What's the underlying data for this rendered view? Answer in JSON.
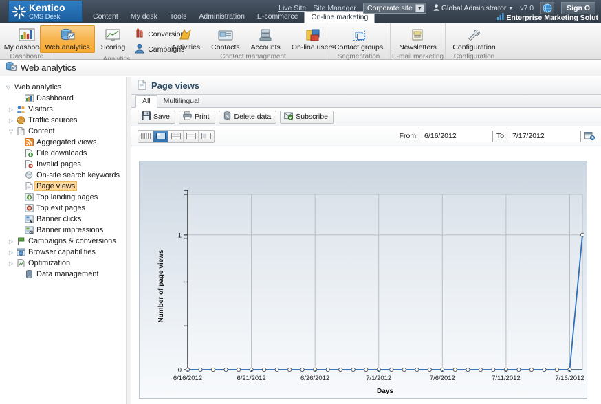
{
  "app": {
    "brand_title": "Kentico",
    "brand_subtitle": "CMS Desk",
    "accent_blue": "#1b5e9e",
    "accent_orange": "#f6a92f"
  },
  "topbar": {
    "nav": [
      {
        "label": "Content",
        "active": false
      },
      {
        "label": "My desk",
        "active": false
      },
      {
        "label": "Tools",
        "active": false
      },
      {
        "label": "Administration",
        "active": false
      },
      {
        "label": "E-commerce",
        "active": false
      },
      {
        "label": "On-line marketing",
        "active": true
      }
    ],
    "live_site": "Live Site",
    "site_manager": "Site Manager",
    "site_selected": "Corporate site",
    "user": "Global Administrator",
    "version": "v7.0",
    "sign_out": "Sign O",
    "slogan": "Enterprise Marketing Solut"
  },
  "ribbon": {
    "groups": [
      {
        "label": "Dashboard",
        "buttons": [
          {
            "label": "My dashboard",
            "icon": "dashboard-icon",
            "selected": false,
            "layout": "large"
          }
        ]
      },
      {
        "label": "Analytics",
        "buttons": [
          {
            "label": "Web analytics",
            "icon": "web-analytics-icon",
            "selected": true,
            "layout": "large"
          },
          {
            "label": "Scoring",
            "icon": "scoring-icon",
            "selected": false,
            "layout": "large"
          },
          {
            "label": "Conversions",
            "icon": "conversions-icon",
            "selected": false,
            "layout": "small"
          },
          {
            "label": "Campaigns",
            "icon": "campaigns-icon",
            "selected": false,
            "layout": "small"
          }
        ]
      },
      {
        "label": "Contact management",
        "buttons": [
          {
            "label": "Activities",
            "icon": "activities-icon",
            "selected": false,
            "layout": "large"
          },
          {
            "label": "Contacts",
            "icon": "contacts-icon",
            "selected": false,
            "layout": "large"
          },
          {
            "label": "Accounts",
            "icon": "accounts-icon",
            "selected": false,
            "layout": "large"
          },
          {
            "label": "On-line users",
            "icon": "online-users-icon",
            "selected": false,
            "layout": "large"
          }
        ]
      },
      {
        "label": "Segmentation",
        "buttons": [
          {
            "label": "Contact groups",
            "icon": "contact-groups-icon",
            "selected": false,
            "layout": "large"
          }
        ]
      },
      {
        "label": "E-mail marketing",
        "buttons": [
          {
            "label": "Newsletters",
            "icon": "newsletters-icon",
            "selected": false,
            "layout": "large"
          }
        ]
      },
      {
        "label": "Configuration",
        "buttons": [
          {
            "label": "Configuration",
            "icon": "wrench-icon",
            "selected": false,
            "layout": "large"
          }
        ]
      }
    ]
  },
  "pagebar": {
    "title": "Web analytics"
  },
  "tree": {
    "items": [
      {
        "label": "Web analytics",
        "indent": 0,
        "expander": "expanded",
        "icon": "none",
        "selected": false
      },
      {
        "label": "Dashboard",
        "indent": 1,
        "expander": "none",
        "icon": "dashboard-icon",
        "selected": false
      },
      {
        "label": "Visitors",
        "indent": 1,
        "expander": "collapsed",
        "icon": "visitors-icon",
        "selected": false
      },
      {
        "label": "Traffic sources",
        "indent": 1,
        "expander": "collapsed",
        "icon": "traffic-icon",
        "selected": false
      },
      {
        "label": "Content",
        "indent": 1,
        "expander": "expanded",
        "icon": "content-icon",
        "selected": false
      },
      {
        "label": "Aggregated views",
        "indent": 2,
        "expander": "none",
        "icon": "rss-icon",
        "selected": false
      },
      {
        "label": "File downloads",
        "indent": 2,
        "expander": "none",
        "icon": "download-icon",
        "selected": false
      },
      {
        "label": "Invalid pages",
        "indent": 2,
        "expander": "none",
        "icon": "invalid-page-icon",
        "selected": false
      },
      {
        "label": "On-site search keywords",
        "indent": 2,
        "expander": "none",
        "icon": "search-keywords-icon",
        "selected": false
      },
      {
        "label": "Page views",
        "indent": 2,
        "expander": "none",
        "icon": "page-icon",
        "selected": true
      },
      {
        "label": "Top landing pages",
        "indent": 2,
        "expander": "none",
        "icon": "landing-page-icon",
        "selected": false
      },
      {
        "label": "Top exit pages",
        "indent": 2,
        "expander": "none",
        "icon": "exit-page-icon",
        "selected": false
      },
      {
        "label": "Banner clicks",
        "indent": 2,
        "expander": "none",
        "icon": "banner-click-icon",
        "selected": false
      },
      {
        "label": "Banner impressions",
        "indent": 2,
        "expander": "none",
        "icon": "banner-impress-icon",
        "selected": false
      },
      {
        "label": "Campaigns & conversions",
        "indent": 1,
        "expander": "collapsed",
        "icon": "flag-icon",
        "selected": false
      },
      {
        "label": "Browser capabilities",
        "indent": 1,
        "expander": "collapsed",
        "icon": "browser-icon",
        "selected": false
      },
      {
        "label": "Optimization",
        "indent": 1,
        "expander": "collapsed",
        "icon": "optimization-icon",
        "selected": false
      },
      {
        "label": "Data management",
        "indent": 1,
        "expander": "none",
        "icon": "data-mgmt-icon",
        "selected": false
      }
    ]
  },
  "content": {
    "header_title": "Page views",
    "tabs": [
      {
        "label": "All",
        "active": true
      },
      {
        "label": "Multilingual",
        "active": false
      }
    ],
    "actions": [
      {
        "label": "Save",
        "icon": "save-icon"
      },
      {
        "label": "Print",
        "icon": "print-icon"
      },
      {
        "label": "Delete data",
        "icon": "delete-icon"
      },
      {
        "label": "Subscribe",
        "icon": "subscribe-icon"
      }
    ],
    "view_modes": [
      {
        "name": "table-view",
        "active": false
      },
      {
        "name": "chart-view",
        "active": true
      },
      {
        "name": "chart-table-view",
        "active": false
      },
      {
        "name": "split-view",
        "active": false
      },
      {
        "name": "side-view",
        "active": false
      }
    ],
    "filter": {
      "from_label": "From:",
      "from_value": "6/16/2012",
      "to_label": "To:",
      "to_value": "7/17/2012",
      "calendar_icon": "calendar-icon"
    }
  },
  "chart_data": {
    "type": "line",
    "title": "",
    "xlabel": "Days",
    "ylabel": "Number of page views",
    "ylim": [
      0,
      1.3
    ],
    "yticks": [
      0,
      1
    ],
    "ytick_labels": [
      "0",
      "1"
    ],
    "grid": true,
    "legend": false,
    "line_color": "#2f6fb5",
    "marker": "circle-open",
    "x": [
      "6/16/2012",
      "6/17/2012",
      "6/18/2012",
      "6/19/2012",
      "6/20/2012",
      "6/21/2012",
      "6/22/2012",
      "6/23/2012",
      "6/24/2012",
      "6/25/2012",
      "6/26/2012",
      "6/27/2012",
      "6/28/2012",
      "6/29/2012",
      "6/30/2012",
      "7/1/2012",
      "7/2/2012",
      "7/3/2012",
      "7/4/2012",
      "7/5/2012",
      "7/6/2012",
      "7/7/2012",
      "7/8/2012",
      "7/9/2012",
      "7/10/2012",
      "7/11/2012",
      "7/12/2012",
      "7/13/2012",
      "7/14/2012",
      "7/15/2012",
      "7/16/2012",
      "7/17/2012"
    ],
    "xtick_labels": [
      "6/16/2012",
      "6/21/2012",
      "6/26/2012",
      "7/1/2012",
      "7/6/2012",
      "7/11/2012",
      "7/16/2012"
    ],
    "xtick_indices": [
      0,
      5,
      10,
      15,
      20,
      25,
      30
    ],
    "values": [
      0,
      0,
      0,
      0,
      0,
      0,
      0,
      0,
      0,
      0,
      0,
      0,
      0,
      0,
      0,
      0,
      0,
      0,
      0,
      0,
      0,
      0,
      0,
      0,
      0,
      0,
      0,
      0,
      0,
      0,
      0,
      1
    ]
  }
}
